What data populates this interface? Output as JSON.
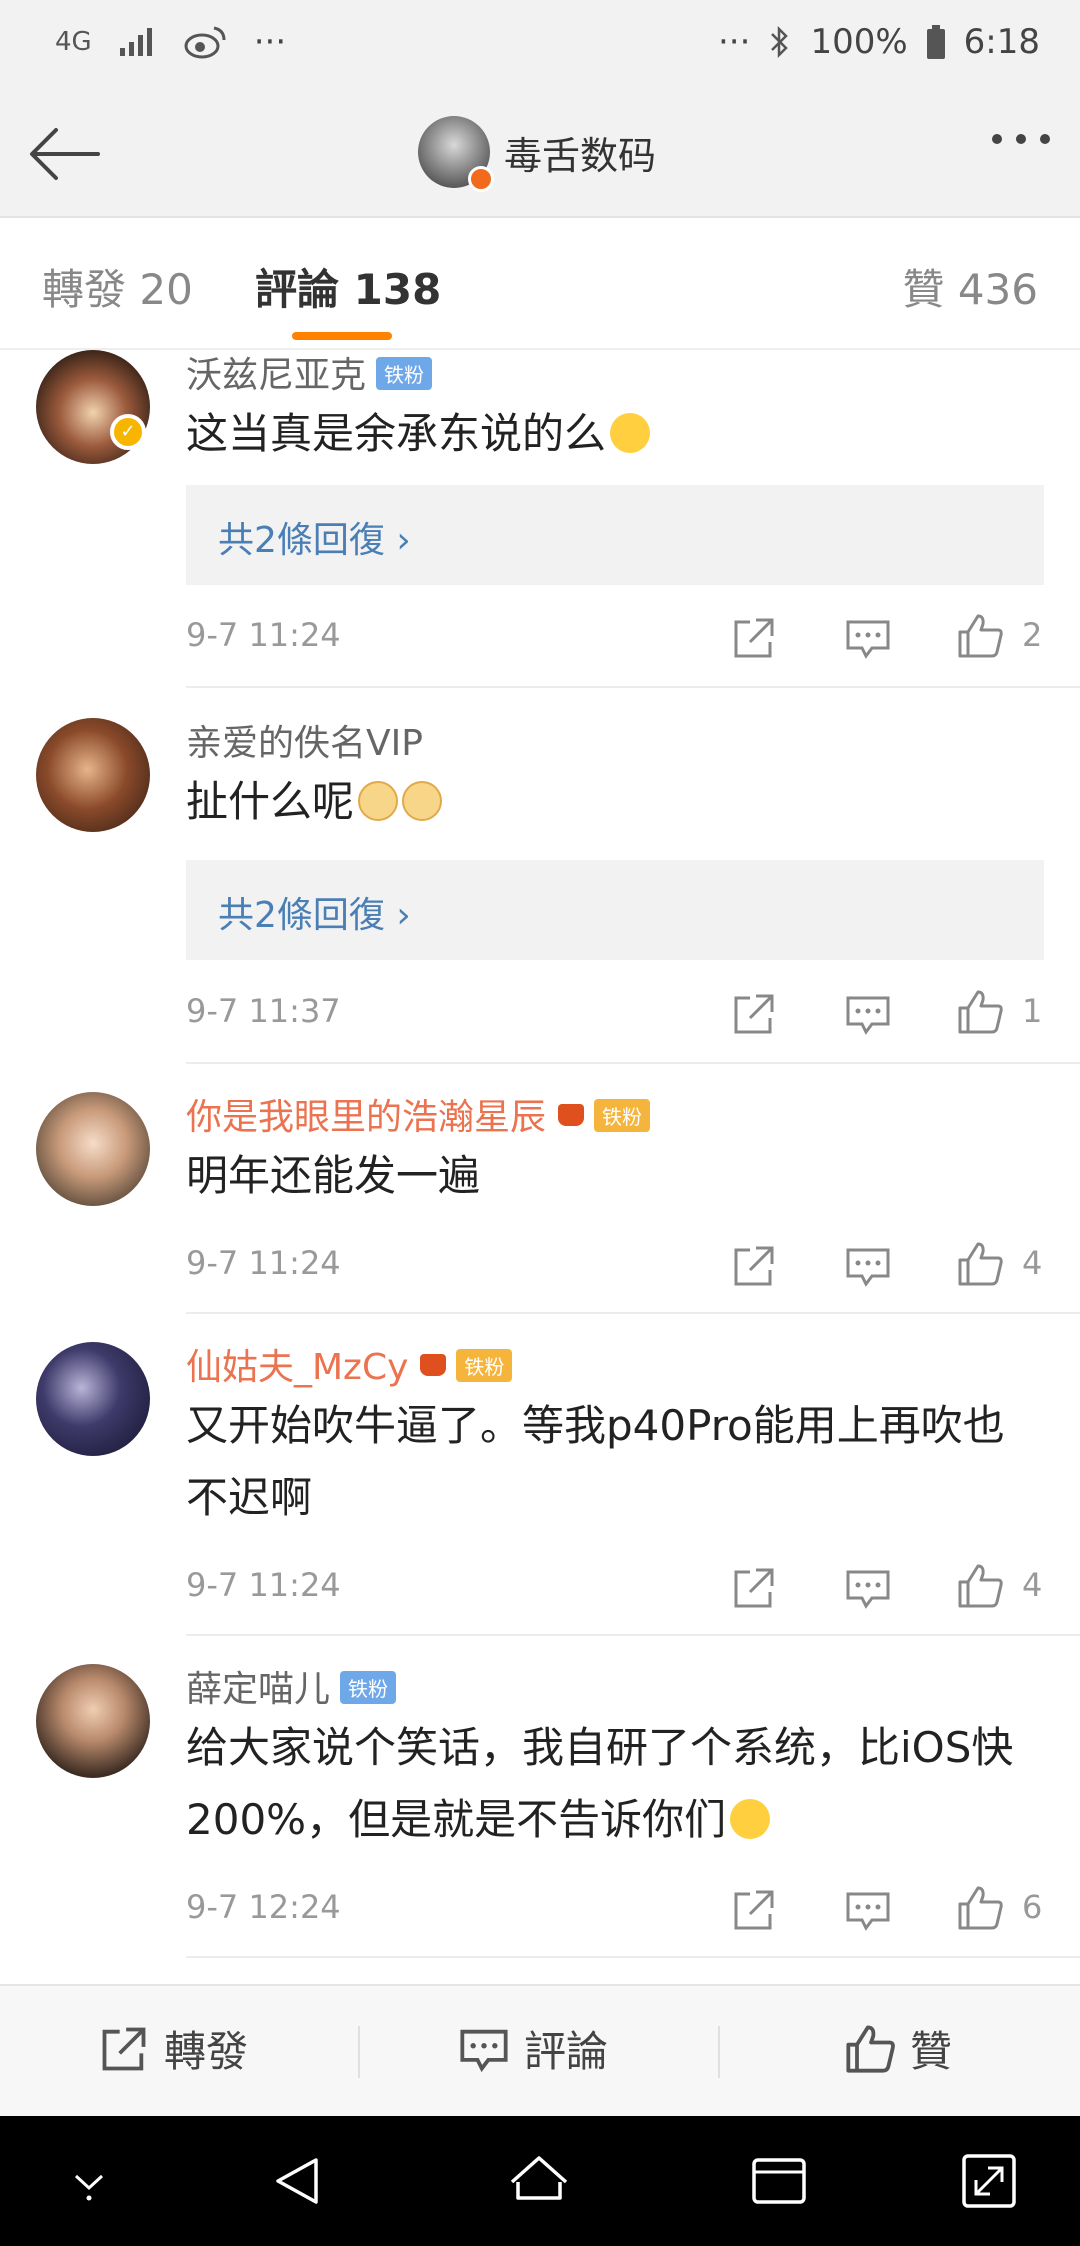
{
  "status_bar": {
    "network": "4G",
    "overflow": "···",
    "battery": "100%",
    "time": "6:18"
  },
  "header": {
    "title": "毒舌数码",
    "back_icon": "arrow-left-icon",
    "more_icon": "more-dots-icon"
  },
  "tabs": {
    "repost": "轉發 20",
    "comments": "評論 138",
    "likes": "贊 436",
    "active_color": "#ff8200"
  },
  "comments": [
    {
      "user": "沃兹尼亚克",
      "badge": "铁粉",
      "text": "这当真是余承东说的么",
      "replies": "共2條回復 ›",
      "time": "9-7 11:24",
      "likes": "2"
    },
    {
      "user": "亲爱的佚名VIP",
      "text": "扯什么呢",
      "replies": "共2條回復 ›",
      "time": "9-7 11:37",
      "likes": "1"
    },
    {
      "user": "你是我眼里的浩瀚星辰",
      "badge": "铁粉",
      "text": "明年还能发一遍",
      "time": "9-7 11:24",
      "likes": "4"
    },
    {
      "user": "仙姑夫_MzCy",
      "badge": "铁粉",
      "text": "又开始吹牛逼了。等我p40Pro能用上再吹也不迟啊",
      "time": "9-7 11:24",
      "likes": "4"
    },
    {
      "user": "薛定喵儿",
      "badge": "铁粉",
      "text": "给大家说个笑话，我自研了个系统，比iOS快200%，但是就是不告诉你们",
      "time": "9-7 12:24",
      "likes": "6"
    }
  ],
  "bottom_bar": {
    "repost": "轉發",
    "comment": "評論",
    "like": "贊"
  },
  "colors": {
    "accent": "#ff8200",
    "vip_name": "#eb7350",
    "link": "#4a7fb5"
  }
}
